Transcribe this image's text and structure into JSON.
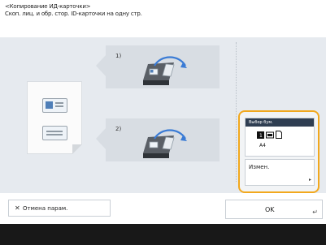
{
  "header": {
    "title": "<Копирование ИД-карточки>",
    "subtitle": "Скоп. лиц. и обр. стор. ID-карточки на одну стр."
  },
  "steps": [
    {
      "label": "1)"
    },
    {
      "label": "2)"
    }
  ],
  "paper": {
    "header": "Выбор бум.",
    "size": "A4",
    "change_label": "Измен."
  },
  "buttons": {
    "cancel_label": "Отмена парам.",
    "ok_label": "OK"
  },
  "colors": {
    "accent": "#f2a81d",
    "arrow": "#3a7bd5",
    "panel": "#e6eaef"
  }
}
